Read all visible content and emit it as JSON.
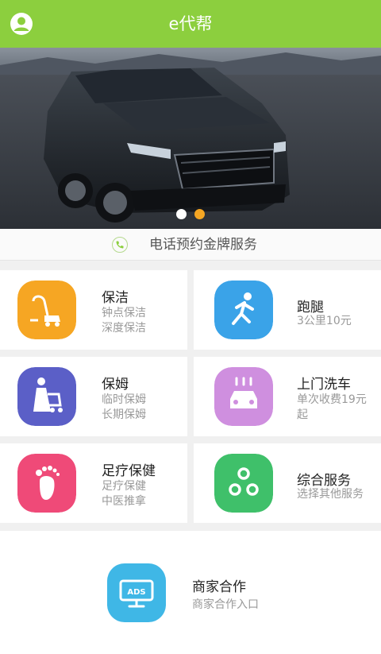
{
  "header": {
    "title": "e代帮",
    "user_icon": "user-circle-icon"
  },
  "banner": {
    "image": "car-photo",
    "slide_count": 2,
    "active_slide": 2
  },
  "phone_bar": {
    "text": "电话预约金牌服务",
    "icon": "phone-icon"
  },
  "services": [
    {
      "title": "保洁",
      "lines": [
        "钟点保洁",
        "深度保洁"
      ],
      "icon": "vacuum-cleaner-icon",
      "color": "#f6a623"
    },
    {
      "title": "跑腿",
      "lines": [
        "3公里10元"
      ],
      "icon": "running-person-icon",
      "color": "#3aa3e8"
    },
    {
      "title": "保姆",
      "lines": [
        "临时保姆",
        "长期保姆"
      ],
      "icon": "nanny-stroller-icon",
      "color": "#5b5fc7"
    },
    {
      "title": "上门洗车",
      "lines": [
        "单次收费19元",
        "起"
      ],
      "icon": "car-wash-icon",
      "color": "#cf8fdf"
    },
    {
      "title": "足疗保健",
      "lines": [
        "足疗保健",
        "中医推拿"
      ],
      "icon": "foot-icon",
      "color": "#ef4a78"
    },
    {
      "title": "综合服务",
      "lines": [
        "选择其他服务"
      ],
      "icon": "three-circles-icon",
      "color": "#3fc06a"
    }
  ],
  "partner": {
    "title": "商家合作",
    "subtitle": "商家合作入口",
    "icon": "ads-monitor-icon",
    "icon_text": "ADS",
    "color": "#3fb7e6"
  }
}
